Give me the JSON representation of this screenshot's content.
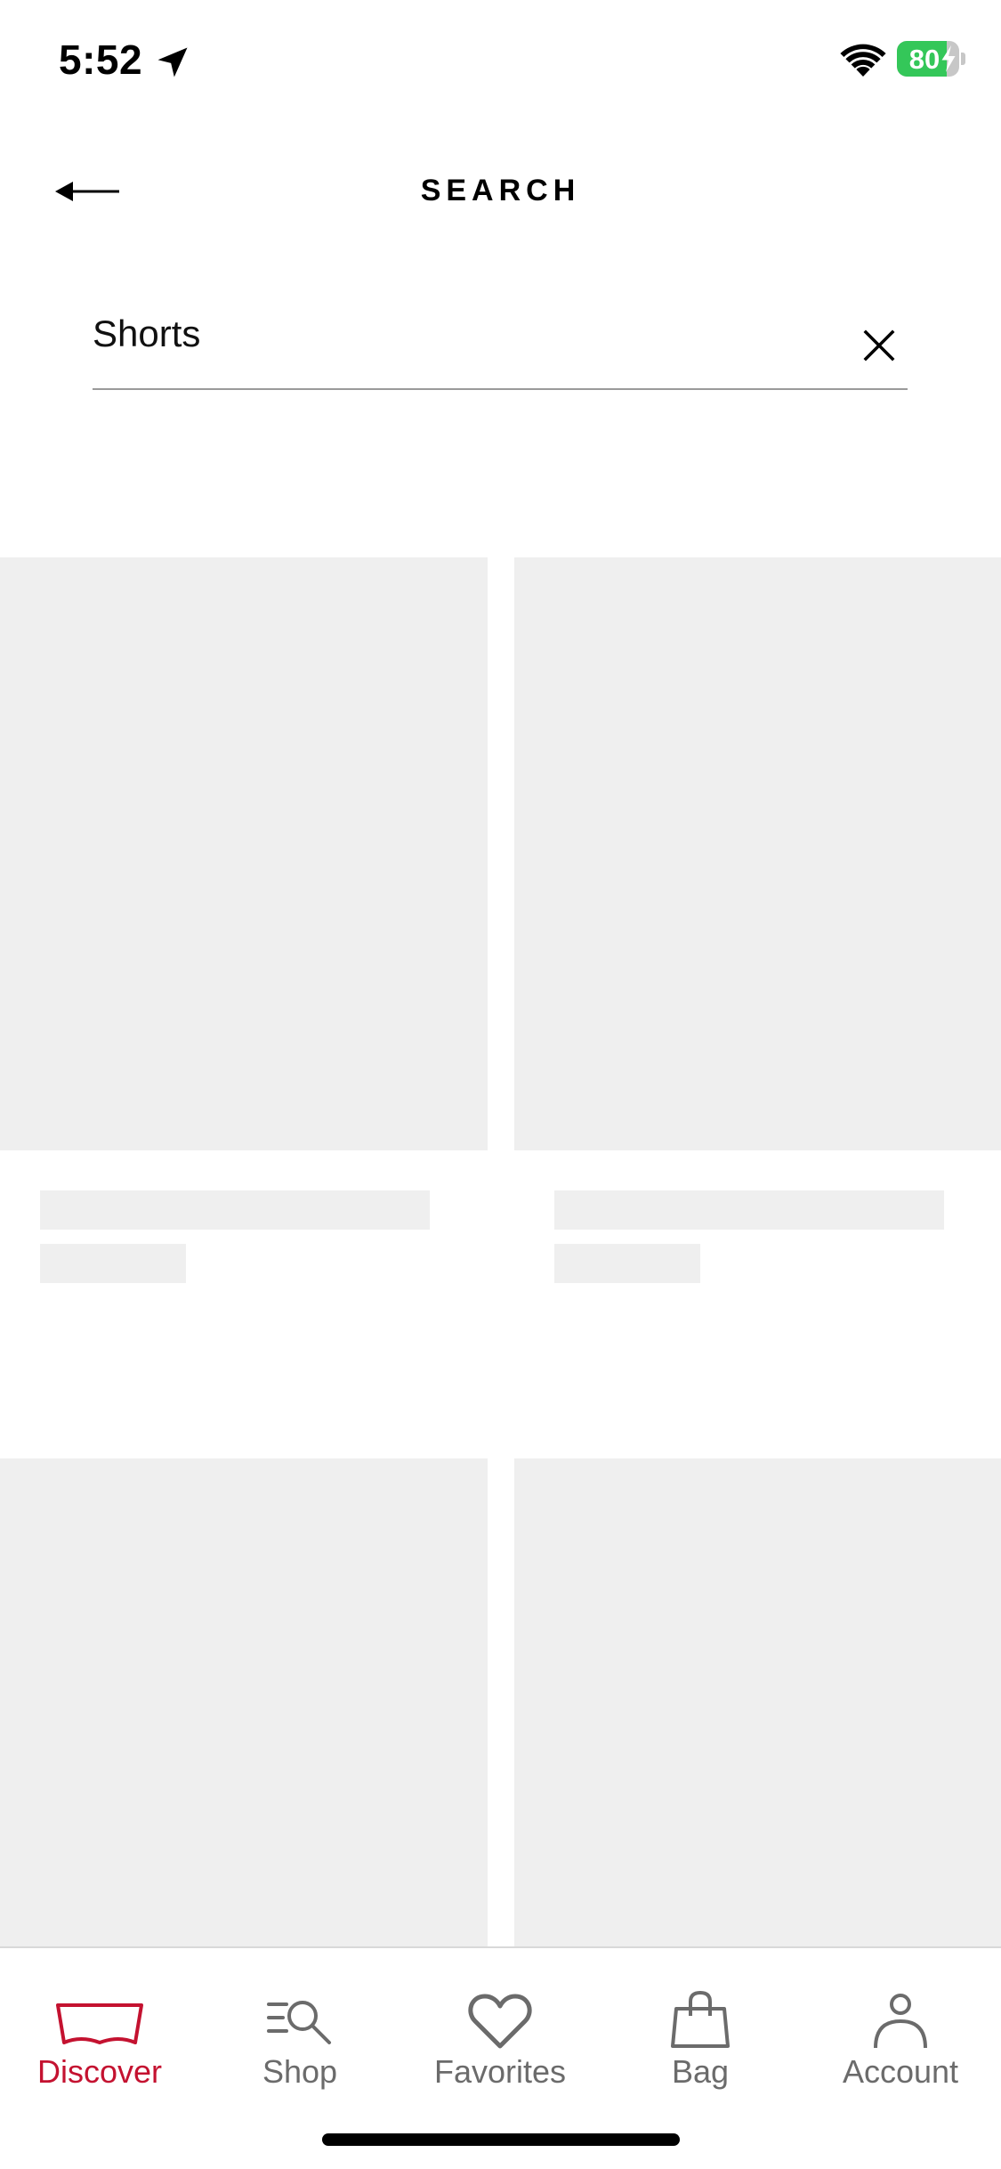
{
  "status_bar": {
    "time": "5:52",
    "battery_level": "80",
    "battery_fraction": 0.8,
    "battery_color": "#34c759"
  },
  "header": {
    "title": "SEARCH",
    "back_icon": "arrow-left-icon"
  },
  "search": {
    "value": "Shorts",
    "clear_icon": "close-icon"
  },
  "results": {
    "state": "loading",
    "skeleton_color": "#efefef"
  },
  "tab_bar": {
    "active_color": "#c41230",
    "inactive_color": "#6b6b6b",
    "items": [
      {
        "label": "Discover",
        "icon": "batwing-logo-icon",
        "active": true
      },
      {
        "label": "Shop",
        "icon": "search-menu-icon",
        "active": false
      },
      {
        "label": "Favorites",
        "icon": "heart-icon",
        "active": false
      },
      {
        "label": "Bag",
        "icon": "shopping-bag-icon",
        "active": false
      },
      {
        "label": "Account",
        "icon": "person-icon",
        "active": false
      }
    ]
  }
}
